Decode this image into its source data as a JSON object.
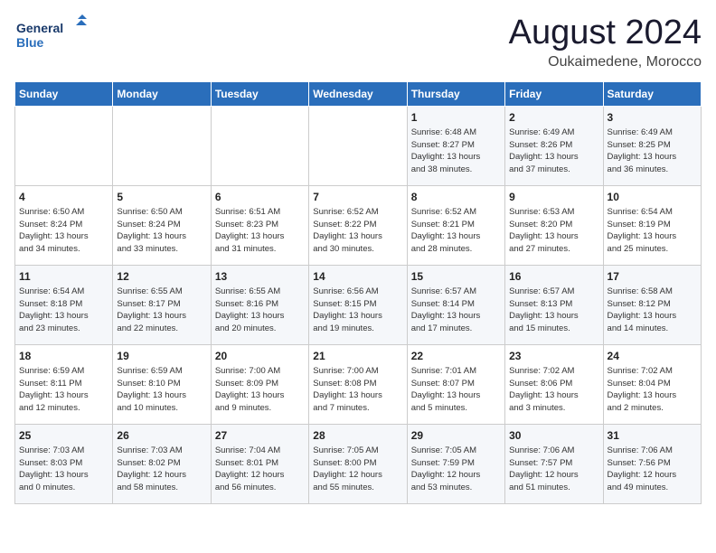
{
  "logo": {
    "line1": "General",
    "line2": "Blue"
  },
  "title": "August 2024",
  "location": "Oukaimedene, Morocco",
  "headers": [
    "Sunday",
    "Monday",
    "Tuesday",
    "Wednesday",
    "Thursday",
    "Friday",
    "Saturday"
  ],
  "weeks": [
    [
      {
        "day": "",
        "info": ""
      },
      {
        "day": "",
        "info": ""
      },
      {
        "day": "",
        "info": ""
      },
      {
        "day": "",
        "info": ""
      },
      {
        "day": "1",
        "info": "Sunrise: 6:48 AM\nSunset: 8:27 PM\nDaylight: 13 hours\nand 38 minutes."
      },
      {
        "day": "2",
        "info": "Sunrise: 6:49 AM\nSunset: 8:26 PM\nDaylight: 13 hours\nand 37 minutes."
      },
      {
        "day": "3",
        "info": "Sunrise: 6:49 AM\nSunset: 8:25 PM\nDaylight: 13 hours\nand 36 minutes."
      }
    ],
    [
      {
        "day": "4",
        "info": "Sunrise: 6:50 AM\nSunset: 8:24 PM\nDaylight: 13 hours\nand 34 minutes."
      },
      {
        "day": "5",
        "info": "Sunrise: 6:50 AM\nSunset: 8:24 PM\nDaylight: 13 hours\nand 33 minutes."
      },
      {
        "day": "6",
        "info": "Sunrise: 6:51 AM\nSunset: 8:23 PM\nDaylight: 13 hours\nand 31 minutes."
      },
      {
        "day": "7",
        "info": "Sunrise: 6:52 AM\nSunset: 8:22 PM\nDaylight: 13 hours\nand 30 minutes."
      },
      {
        "day": "8",
        "info": "Sunrise: 6:52 AM\nSunset: 8:21 PM\nDaylight: 13 hours\nand 28 minutes."
      },
      {
        "day": "9",
        "info": "Sunrise: 6:53 AM\nSunset: 8:20 PM\nDaylight: 13 hours\nand 27 minutes."
      },
      {
        "day": "10",
        "info": "Sunrise: 6:54 AM\nSunset: 8:19 PM\nDaylight: 13 hours\nand 25 minutes."
      }
    ],
    [
      {
        "day": "11",
        "info": "Sunrise: 6:54 AM\nSunset: 8:18 PM\nDaylight: 13 hours\nand 23 minutes."
      },
      {
        "day": "12",
        "info": "Sunrise: 6:55 AM\nSunset: 8:17 PM\nDaylight: 13 hours\nand 22 minutes."
      },
      {
        "day": "13",
        "info": "Sunrise: 6:55 AM\nSunset: 8:16 PM\nDaylight: 13 hours\nand 20 minutes."
      },
      {
        "day": "14",
        "info": "Sunrise: 6:56 AM\nSunset: 8:15 PM\nDaylight: 13 hours\nand 19 minutes."
      },
      {
        "day": "15",
        "info": "Sunrise: 6:57 AM\nSunset: 8:14 PM\nDaylight: 13 hours\nand 17 minutes."
      },
      {
        "day": "16",
        "info": "Sunrise: 6:57 AM\nSunset: 8:13 PM\nDaylight: 13 hours\nand 15 minutes."
      },
      {
        "day": "17",
        "info": "Sunrise: 6:58 AM\nSunset: 8:12 PM\nDaylight: 13 hours\nand 14 minutes."
      }
    ],
    [
      {
        "day": "18",
        "info": "Sunrise: 6:59 AM\nSunset: 8:11 PM\nDaylight: 13 hours\nand 12 minutes."
      },
      {
        "day": "19",
        "info": "Sunrise: 6:59 AM\nSunset: 8:10 PM\nDaylight: 13 hours\nand 10 minutes."
      },
      {
        "day": "20",
        "info": "Sunrise: 7:00 AM\nSunset: 8:09 PM\nDaylight: 13 hours\nand 9 minutes."
      },
      {
        "day": "21",
        "info": "Sunrise: 7:00 AM\nSunset: 8:08 PM\nDaylight: 13 hours\nand 7 minutes."
      },
      {
        "day": "22",
        "info": "Sunrise: 7:01 AM\nSunset: 8:07 PM\nDaylight: 13 hours\nand 5 minutes."
      },
      {
        "day": "23",
        "info": "Sunrise: 7:02 AM\nSunset: 8:06 PM\nDaylight: 13 hours\nand 3 minutes."
      },
      {
        "day": "24",
        "info": "Sunrise: 7:02 AM\nSunset: 8:04 PM\nDaylight: 13 hours\nand 2 minutes."
      }
    ],
    [
      {
        "day": "25",
        "info": "Sunrise: 7:03 AM\nSunset: 8:03 PM\nDaylight: 13 hours\nand 0 minutes."
      },
      {
        "day": "26",
        "info": "Sunrise: 7:03 AM\nSunset: 8:02 PM\nDaylight: 12 hours\nand 58 minutes."
      },
      {
        "day": "27",
        "info": "Sunrise: 7:04 AM\nSunset: 8:01 PM\nDaylight: 12 hours\nand 56 minutes."
      },
      {
        "day": "28",
        "info": "Sunrise: 7:05 AM\nSunset: 8:00 PM\nDaylight: 12 hours\nand 55 minutes."
      },
      {
        "day": "29",
        "info": "Sunrise: 7:05 AM\nSunset: 7:59 PM\nDaylight: 12 hours\nand 53 minutes."
      },
      {
        "day": "30",
        "info": "Sunrise: 7:06 AM\nSunset: 7:57 PM\nDaylight: 12 hours\nand 51 minutes."
      },
      {
        "day": "31",
        "info": "Sunrise: 7:06 AM\nSunset: 7:56 PM\nDaylight: 12 hours\nand 49 minutes."
      }
    ]
  ]
}
